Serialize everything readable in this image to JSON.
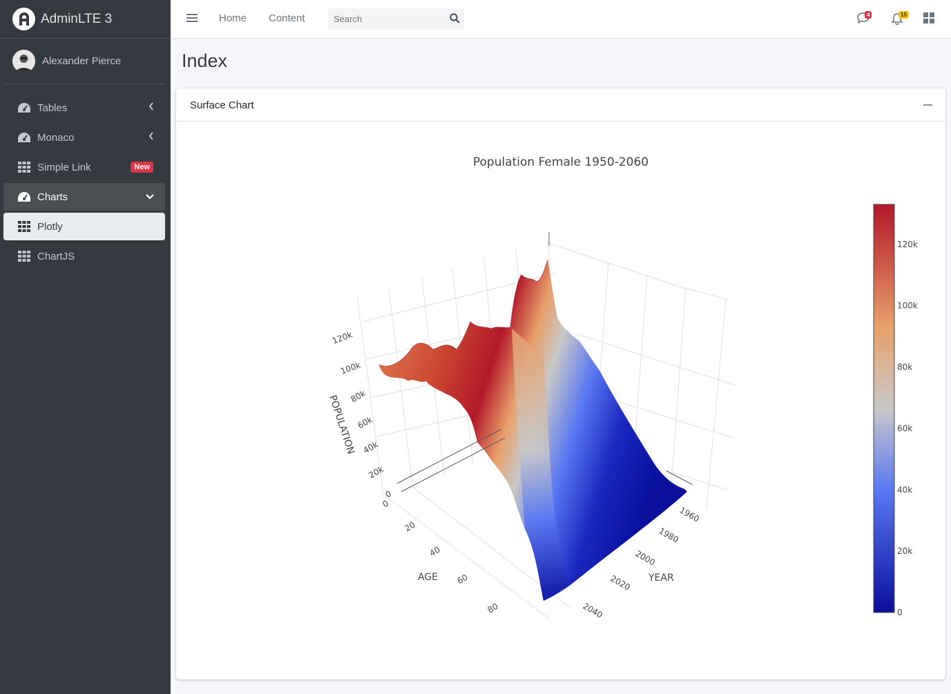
{
  "brand": {
    "name": "AdminLTE 3"
  },
  "user": {
    "name": "Alexander Pierce"
  },
  "sidebar": {
    "items": [
      {
        "label": "Tables",
        "icon": "tachometer-icon",
        "state": "collapsed"
      },
      {
        "label": "Monaco",
        "icon": "tachometer-icon",
        "state": "collapsed"
      },
      {
        "label": "Simple Link",
        "icon": "grid-icon",
        "badge": "New"
      },
      {
        "label": "Charts",
        "icon": "tachometer-icon",
        "state": "open"
      },
      {
        "label": "Plotly",
        "icon": "grid-icon",
        "state": "active"
      },
      {
        "label": "ChartJS",
        "icon": "grid-icon"
      }
    ]
  },
  "navbar": {
    "links": [
      "Home",
      "Content"
    ],
    "search_placeholder": "Search",
    "messages_count": "4",
    "notifications_count": "15"
  },
  "page": {
    "title": "Index"
  },
  "card": {
    "title": "Surface Chart"
  },
  "colors": {
    "sidebar_bg": "#343a40",
    "danger": "#dc3545",
    "warning": "#ffc107"
  },
  "chart_data": {
    "type": "surface",
    "title": "Population Female 1950-2060",
    "xlabel": "AGE",
    "ylabel": "YEAR",
    "zlabel": "POPULATION",
    "x_ticks": [
      "0",
      "20",
      "40",
      "60",
      "80"
    ],
    "y_ticks": [
      "1960",
      "1980",
      "2000",
      "2020",
      "2040"
    ],
    "z_ticks": [
      "0",
      "20k",
      "40k",
      "60k",
      "80k",
      "100k",
      "120k"
    ],
    "colorbar_ticks": [
      "0",
      "20k",
      "40k",
      "60k",
      "80k",
      "100k",
      "120k"
    ],
    "zlim": [
      0,
      133000
    ],
    "colorscale": [
      "#0a0f9c",
      "#5a78f2",
      "#c8c8c8",
      "#e8a06a",
      "#b2182b"
    ]
  }
}
